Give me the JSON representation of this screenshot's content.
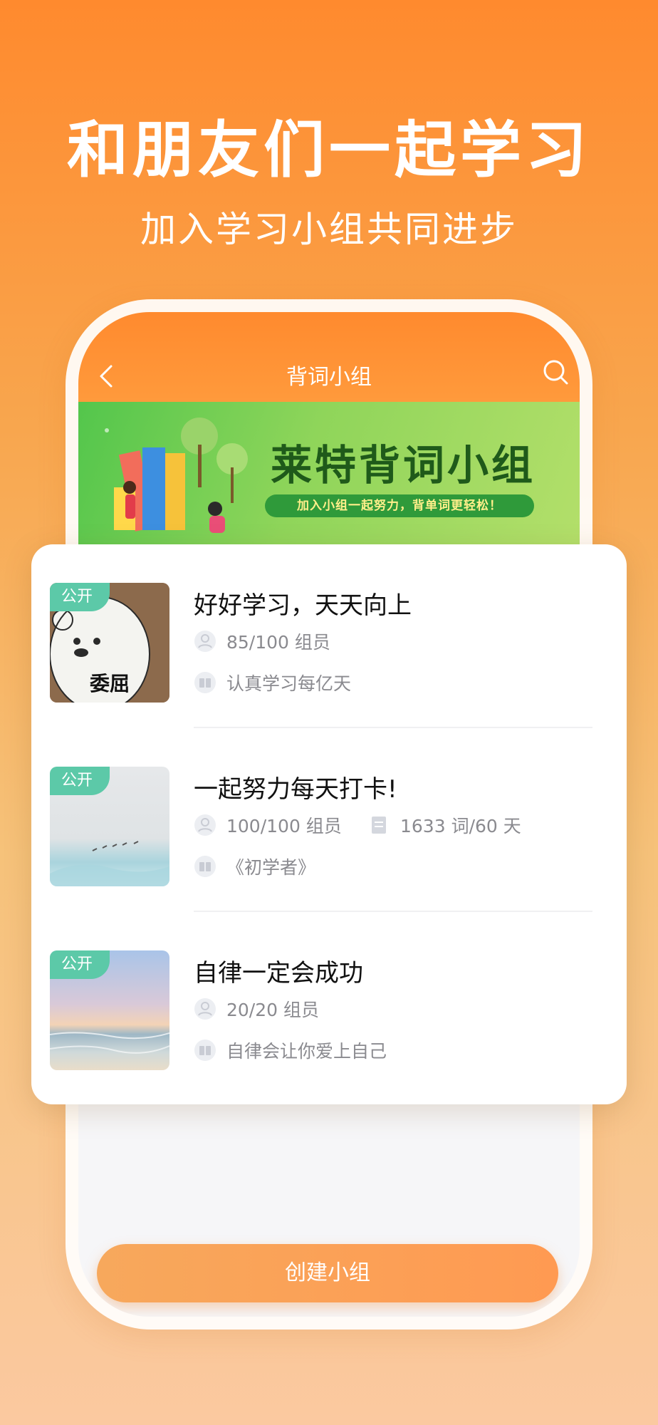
{
  "headline": "和朋友们一起学习",
  "subline": "加入学习小组共同进步",
  "nav": {
    "title": "背词小组",
    "back_icon": "chevron-left-icon",
    "search_icon": "search-icon"
  },
  "banner": {
    "title_part1": "莱特背词",
    "title_part2": "小组",
    "slogan": "加入小组一起努力，背单词更轻松！"
  },
  "groups": [
    {
      "tag": "公开",
      "title": "好好学习，天天向上",
      "members": "85/100 组员",
      "book": "认真学习每亿天",
      "thumb_caption": "委屈"
    },
    {
      "tag": "公开",
      "title": "一起努力每天打卡!",
      "members": "100/100 组员",
      "plan": "1633 词/60 天",
      "book": "《初学者》"
    },
    {
      "tag": "公开",
      "title": "自律一定会成功",
      "members": "20/20 组员",
      "book": "自律会让你爱上自己"
    }
  ],
  "create_button": "创建小组",
  "colors": {
    "brand_orange": "#ff8a2e",
    "tag_green": "#5cc9a8",
    "banner_green": "#53c64c"
  }
}
